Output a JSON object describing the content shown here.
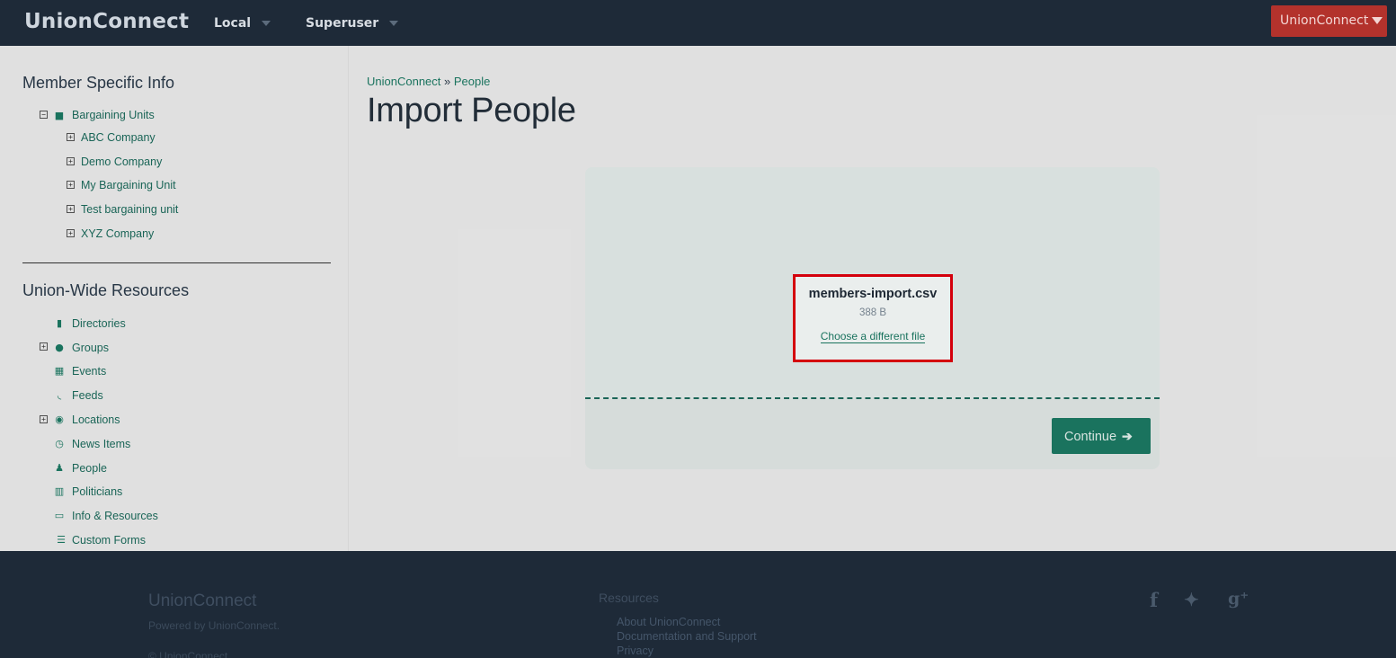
{
  "navbar": {
    "brand": "UnionConnect",
    "local_label": "Local",
    "superuser_label": "Superuser",
    "org_button": "UnionConnect"
  },
  "sidebar": {
    "member_heading": "Member Specific Info",
    "bargaining_label": "Bargaining Units",
    "bargaining_units": [
      "ABC Company",
      "Demo Company",
      "My Bargaining Unit",
      "Test bargaining unit",
      "XYZ Company"
    ],
    "union_heading": "Union-Wide Resources",
    "resources": [
      {
        "label": "Directories",
        "icon": "book-icon",
        "expandable": false
      },
      {
        "label": "Groups",
        "icon": "users-icon",
        "expandable": true
      },
      {
        "label": "Events",
        "icon": "calendar-icon",
        "expandable": false
      },
      {
        "label": "Feeds",
        "icon": "rss-icon",
        "expandable": false
      },
      {
        "label": "Locations",
        "icon": "globe-icon",
        "expandable": true
      },
      {
        "label": "News Items",
        "icon": "clock-icon",
        "expandable": false
      },
      {
        "label": "People",
        "icon": "user-icon",
        "expandable": false
      },
      {
        "label": "Politicians",
        "icon": "building-icon",
        "expandable": false
      },
      {
        "label": "Info & Resources",
        "icon": "folder-open-icon",
        "expandable": false
      },
      {
        "label": "Custom Forms",
        "icon": "list-alt-icon",
        "expandable": false
      }
    ]
  },
  "breadcrumb": {
    "root": "UnionConnect",
    "separator": "»",
    "current": "People"
  },
  "page": {
    "title": "Import People"
  },
  "upload": {
    "file_name": "members-import.csv",
    "file_size": "388 B",
    "change_link": "Choose a different file",
    "continue_label": "Continue"
  },
  "footer": {
    "brand": "UnionConnect",
    "powered": "Powered by UnionConnect.",
    "copyright": "© UnionConnect",
    "resources_title": "Resources",
    "links": [
      "About UnionConnect",
      "Documentation and Support",
      "Privacy"
    ],
    "social": [
      "facebook-icon",
      "twitter-icon",
      "google-plus-icon"
    ]
  },
  "colors": {
    "nav_bg": "#1e2a38",
    "accent": "#1c7a64",
    "org_button": "#b3322c",
    "highlight_border": "#e0000d"
  }
}
